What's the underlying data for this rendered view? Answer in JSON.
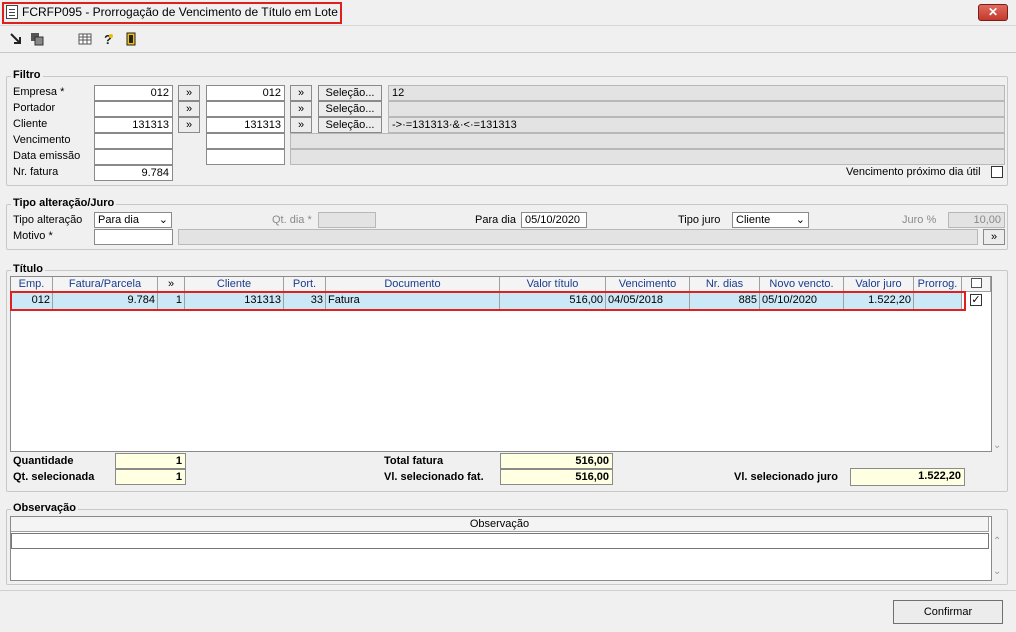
{
  "window": {
    "title": "FCRFP095 - Prorrogação de Vencimento de Título em Lote",
    "close": "✕"
  },
  "toolbar": [
    "arrow-icon",
    "copy-icon",
    "grid-icon",
    "help-icon",
    "exit-icon"
  ],
  "filtro": {
    "legend": "Filtro",
    "empresa": {
      "label": "Empresa *",
      "from": "012",
      "to": "012",
      "sel": "Seleção...",
      "result": "12"
    },
    "portador": {
      "label": "Portador",
      "from": "",
      "to": "",
      "sel": "Seleção...",
      "result": ""
    },
    "cliente": {
      "label": "Cliente",
      "from": "131313",
      "to": "131313",
      "sel": "Seleção...",
      "result": "->·=131313·&·<·=131313"
    },
    "vencimento": {
      "label": "Vencimento",
      "from": "",
      "to": ""
    },
    "data_emissao": {
      "label": "Data emissão",
      "from": "",
      "to": ""
    },
    "nr_fatura": {
      "label": "Nr. fatura",
      "value": "9.784"
    },
    "proximo_dia": "Vencimento próximo dia útil",
    "arrow": "»"
  },
  "tipo": {
    "legend": "Tipo alteração/Juro",
    "tipo_alteracao_label": "Tipo alteração",
    "tipo_alteracao_value": "Para dia",
    "qt_dia_label": "Qt. dia *",
    "qt_dia_value": "",
    "para_dia_label": "Para dia",
    "para_dia_value": "05/10/2020",
    "tipo_juro_label": "Tipo juro",
    "tipo_juro_value": "Cliente",
    "juro_label": "Juro %",
    "juro_value": "10,00",
    "motivo_label": "Motivo *",
    "motivo_value": "",
    "arrow": "»"
  },
  "titulo": {
    "legend": "Título",
    "headers": [
      "Emp.",
      "Fatura/Parcela",
      "»",
      "Cliente",
      "Port.",
      "Documento",
      "Valor título",
      "Vencimento",
      "Nr. dias",
      "Novo vencto.",
      "Valor juro",
      "Prorrog."
    ],
    "row": [
      "012",
      "9.784",
      "1",
      "131313",
      "33",
      "Fatura",
      "516,00",
      "04/05/2018",
      "885",
      "05/10/2020",
      "1.522,20",
      ""
    ],
    "check": "✓"
  },
  "totais": {
    "quantidade_label": "Quantidade",
    "quantidade": "1",
    "qt_sel_label": "Qt. selecionada",
    "qt_sel": "1",
    "total_fatura_label": "Total fatura",
    "total_fatura": "516,00",
    "vl_sel_fat_label": "Vl. selecionado fat.",
    "vl_sel_fat": "516,00",
    "vl_sel_juro_label": "Vl. selecionado juro",
    "vl_sel_juro": "1.522,20"
  },
  "observacao": {
    "legend": "Observação",
    "header": "Observação"
  },
  "confirmar": "Confirmar"
}
